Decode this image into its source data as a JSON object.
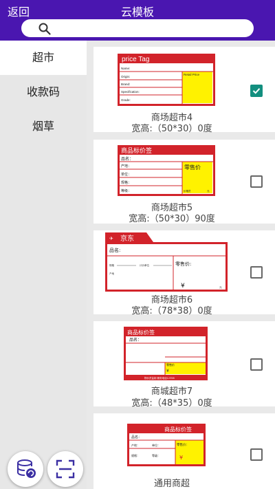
{
  "header": {
    "back_label": "返回",
    "title": "云模板"
  },
  "search": {
    "placeholder": ""
  },
  "sidebar": {
    "items": [
      {
        "label": "超市",
        "active": true
      },
      {
        "label": "收款码",
        "active": false
      },
      {
        "label": "烟草",
        "active": false
      }
    ]
  },
  "templates": [
    {
      "name": "商场超市4",
      "size": "宽高:（50*30）0度",
      "checked": true
    },
    {
      "name": "商场超市5",
      "size": "宽高:（50*30）90度",
      "checked": false
    },
    {
      "name": "商场超市6",
      "size": "宽高:（78*38）0度",
      "checked": false
    },
    {
      "name": "商城超市7",
      "size": "宽高:（48*35）0度",
      "checked": false
    },
    {
      "name": "通用商超",
      "size": "",
      "checked": false
    }
  ],
  "previews": {
    "t1": {
      "title": "price Tag",
      "rows": [
        "Name:",
        "Origin:",
        "Brand:",
        "Specification:",
        "Grade:"
      ],
      "retail": "Retail Price"
    },
    "t2": {
      "title": "商品标价签",
      "rows": [
        "品名：",
        "产地：",
        "单位：",
        "规格：",
        "等级："
      ],
      "retail": "零售价",
      "foot_left": "价格员",
      "foot_right": "元"
    },
    "t3": {
      "logo": "京东",
      "name": "品名:",
      "mid_left": "规格",
      "mid_right": "计价单位",
      "origin": "产地",
      "retail": "零售价:",
      "yen": "¥",
      "yuan": "元"
    },
    "t4": {
      "title": "商品标价签",
      "name": "品名：",
      "retail": "零售价",
      "yen": "¥",
      "foot": "物价员监制  服务电话12358"
    },
    "t5": {
      "title": "商品标价签",
      "name": "品名：",
      "origin": "产地：",
      "unit": "单位：",
      "spec": "规格：",
      "grade": "等级：",
      "retail": "零售价：",
      "yen": "¥"
    }
  },
  "colors": {
    "header": "#4a16b0",
    "tag_red": "#d2232a",
    "tag_yellow": "#fff200",
    "check": "#138f7f"
  },
  "fabs": [
    {
      "icon": "database-sync-icon"
    },
    {
      "icon": "scan-icon"
    }
  ]
}
